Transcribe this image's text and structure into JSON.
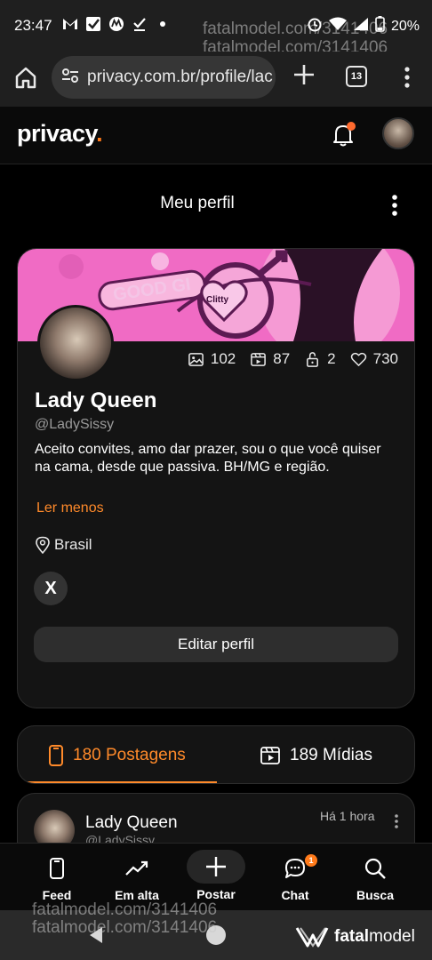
{
  "status_bar": {
    "time": "23:47",
    "battery": "20%",
    "network": "4G",
    "watermark_lines": [
      "fatalmodel.com/3141406",
      "fatalmodel.com/3141406"
    ]
  },
  "browser": {
    "url": "privacy.com.br/profile/lac",
    "tab_count": "13"
  },
  "app": {
    "logo_text": "privacy",
    "logo_dot": ".",
    "accent_color": "#ff8a2a"
  },
  "page": {
    "title": "Meu perfil"
  },
  "profile": {
    "banner_text": "GOOD GI",
    "banner_label": "Clitty",
    "stats": {
      "photos": "102",
      "videos": "87",
      "locked": "2",
      "likes": "730"
    },
    "name": "Lady Queen",
    "handle": "@LadySissy",
    "bio": "Aceito convites, amo dar prazer, sou o que você quiser na cama, desde que passiva. BH/MG e região.",
    "read_less": "Ler menos",
    "location": "Brasil",
    "social_x": "X",
    "edit_button": "Editar perfil"
  },
  "tabs": {
    "posts": "180 Postagens",
    "media": "189 Mídias"
  },
  "post": {
    "name": "Lady Queen",
    "handle": "@LadySissy",
    "time": "Há 1 hora"
  },
  "bottom_nav": {
    "feed": "Feed",
    "trending": "Em alta",
    "post": "Postar",
    "chat": "Chat",
    "chat_badge": "1",
    "search": "Busca"
  },
  "footer": {
    "watermark_lines": [
      "fatalmodel.com/3141406",
      "fatalmodel.com/3141406"
    ],
    "brand_bold": "fatal",
    "brand_rest": "model"
  }
}
